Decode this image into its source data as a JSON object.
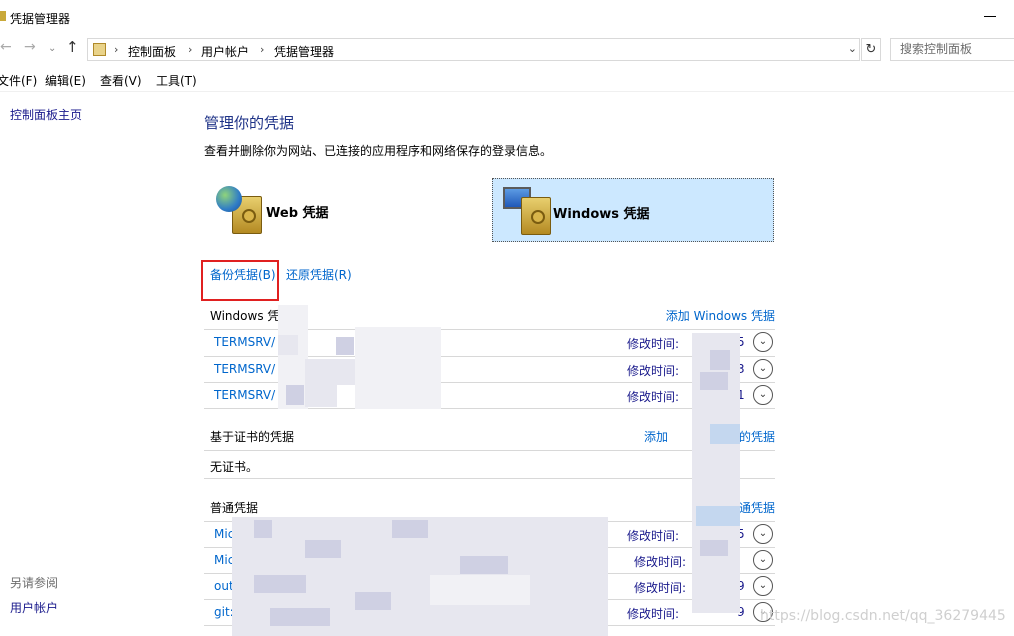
{
  "window": {
    "title": "凭据管理器"
  },
  "address": {
    "crumbs": [
      "控制面板",
      "用户帐户",
      "凭据管理器"
    ],
    "search_placeholder": "搜索控制面板"
  },
  "menu": [
    "文件(F)",
    "编辑(E)",
    "查看(V)",
    "工具(T)"
  ],
  "leftnav": {
    "home": "控制面板主页",
    "see_also": "另请参阅",
    "user_accounts": "用户帐户"
  },
  "main": {
    "title": "管理你的凭据",
    "description": "查看并删除你为网站、已连接的应用程序和网络保存的登录信息。",
    "tiles": {
      "web": "Web 凭据",
      "windows": "Windows 凭据"
    },
    "backup": "备份凭据(B)",
    "restore": "还原凭据(R)"
  },
  "windows_creds": {
    "header": "Windows 凭据",
    "add": "添加 Windows 凭据",
    "rows": [
      {
        "name": "TERMSRV/",
        "modified": "修改时间:",
        "tail": "5"
      },
      {
        "name": "TERMSRV/",
        "modified": "修改时间:",
        "tail": "3"
      },
      {
        "name": "TERMSRV/",
        "modified": "修改时间:",
        "tail": "1"
      }
    ]
  },
  "cert_creds": {
    "header": "基于证书的凭据",
    "add": "添加",
    "add_tail": "的凭据",
    "empty": "无证书。"
  },
  "generic_creds": {
    "header": "普通凭据",
    "add": "通凭据",
    "rows": [
      {
        "name": "Mic",
        "modified": "修改时间:",
        "tail": "5"
      },
      {
        "name": "Mic",
        "modified": "修改时间:",
        "tail": ""
      },
      {
        "name": "out",
        "modified": "修改时间:",
        "tail": "9"
      },
      {
        "name": "git:",
        "modified": "修改时间:",
        "tail": "9"
      }
    ]
  },
  "watermark": "https://blog.csdn.net/qq_36279445"
}
